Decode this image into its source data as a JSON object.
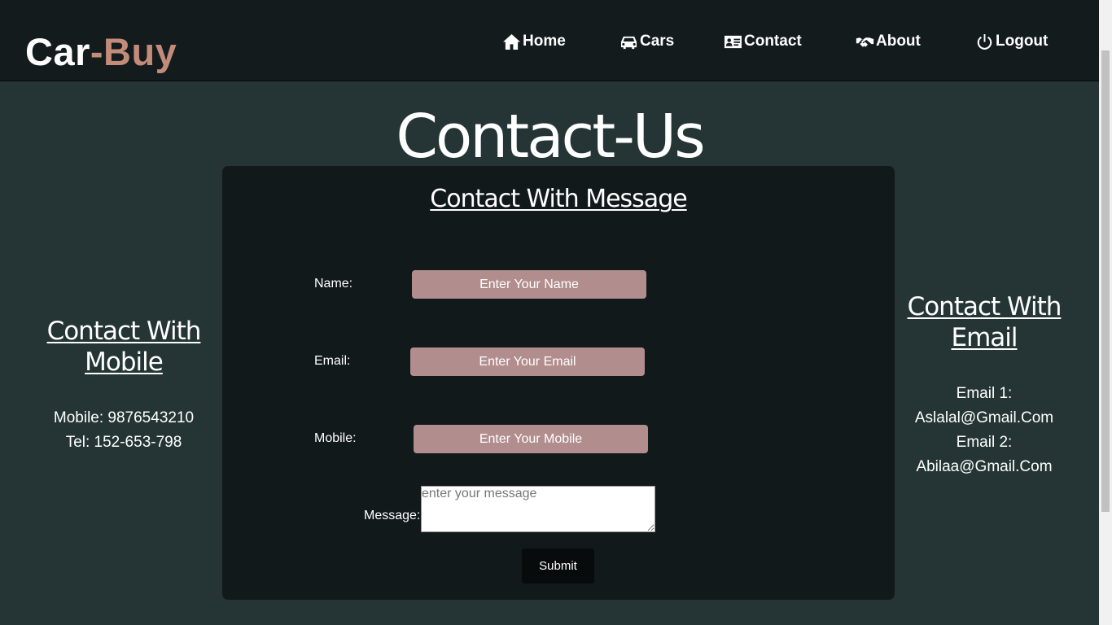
{
  "brand": {
    "part1": "Car",
    "part2": "-Buy"
  },
  "nav": [
    {
      "label": "Home",
      "icon": "home-icon"
    },
    {
      "label": "Cars",
      "icon": "car-icon"
    },
    {
      "label": "Contact",
      "icon": "address-card-icon"
    },
    {
      "label": "About",
      "icon": "handshake-icon"
    },
    {
      "label": "Logout",
      "icon": "power-icon"
    }
  ],
  "page_title": "Contact-Us",
  "mobile_contact": {
    "heading": "Contact With Mobile",
    "mobile": "Mobile: 9876543210",
    "tel": "Tel: 152-653-798"
  },
  "email_contact": {
    "heading": "Contact With Email",
    "email1_label": "Email 1:",
    "email1": "Aslalal@Gmail.Com",
    "email2_label": "Email 2:",
    "email2": "Abilaa@Gmail.Com"
  },
  "form": {
    "title": "Contact With Message",
    "name_label": "Name:",
    "name_placeholder": "Enter Your Name",
    "email_label": "Email:",
    "email_placeholder": "Enter Your Email",
    "mobile_label": "Mobile:",
    "mobile_placeholder": "Enter Your Mobile",
    "message_label": "Message:",
    "message_placeholder": "enter your message",
    "submit_label": "Submit"
  },
  "colors": {
    "background": "#253536",
    "header": "#131b1d",
    "panel": "#12191b",
    "brand_accent": "#c28b7a",
    "input_fill": "#b28d8d"
  }
}
